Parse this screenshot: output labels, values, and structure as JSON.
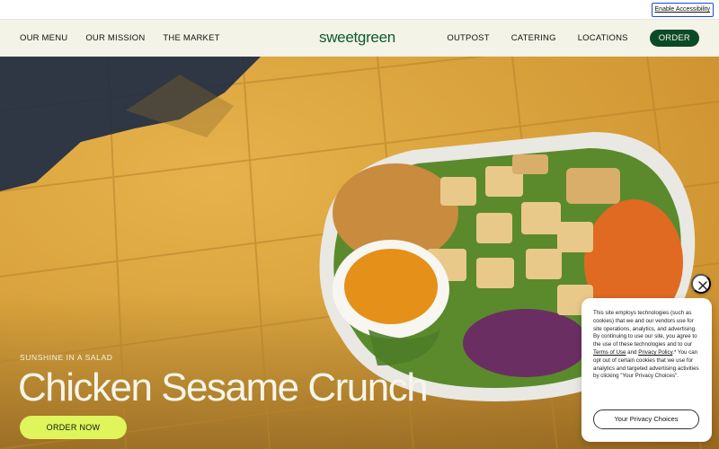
{
  "topbar": {
    "accessibility_label": "Enable Accessibility"
  },
  "nav": {
    "left_items": [
      "OUR MENU",
      "OUR MISSION",
      "THE MARKET"
    ],
    "logo": "sweetgreen",
    "right_items": [
      "OUTPOST",
      "CATERING",
      "LOCATIONS"
    ],
    "order_label": "ORDER"
  },
  "hero": {
    "eyebrow": "SUNSHINE IN A SALAD",
    "headline": "Chicken Sesame Crunch",
    "cta_label": "ORDER NOW"
  },
  "cookie": {
    "text_1": "This site employs technologies (such as cookies) that we and our vendors use for site operations, analytics, and advertising. By continuing to use our site, you agree to the use of these technologies and to our ",
    "terms_link": "Terms of Use",
    "text_2": " and ",
    "privacy_link": "Privacy Policy",
    "text_3": ".* You can opt out of certain cookies that we use for analytics and targeted advertising activities by clicking \"Your Privacy Choices\".",
    "button_label": "Your Privacy Choices"
  },
  "colors": {
    "brand_green": "#0b5c2e",
    "order_button": "#0b4a26",
    "cta_lime": "#dff55b",
    "nav_background": "#f4f3e7"
  },
  "icons": {
    "close": "close-icon"
  }
}
